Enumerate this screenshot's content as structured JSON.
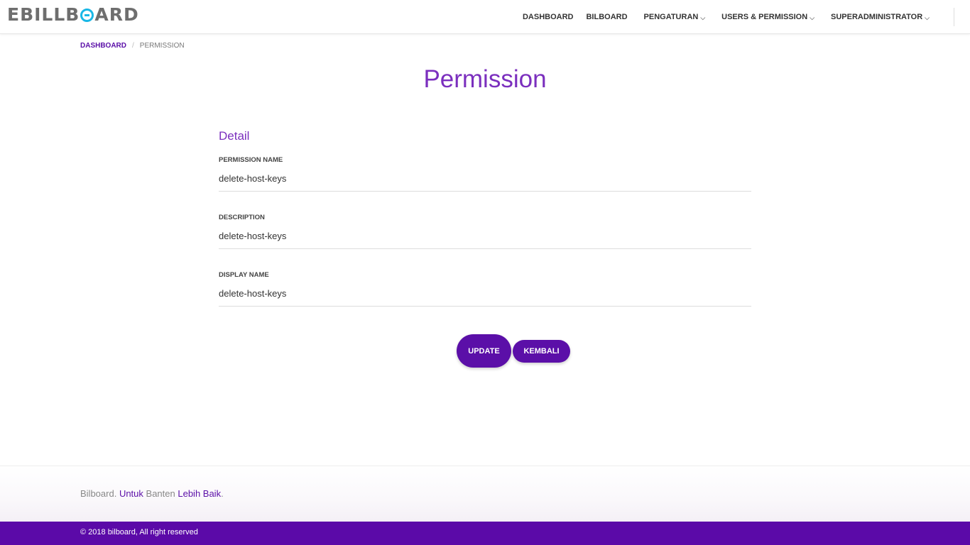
{
  "brand": {
    "logo_prefix": "EBILLB",
    "logo_suffix": "ARD",
    "accent_color": "#5b0fa8",
    "logo_mark_color": "#19b7e6"
  },
  "nav": {
    "items": [
      {
        "label": "DASHBOARD",
        "dropdown": false
      },
      {
        "label": "BILBOARD",
        "dropdown": false
      },
      {
        "label": "PENGATURAN",
        "dropdown": true
      },
      {
        "label": "USERS & PERMISSION",
        "dropdown": true
      },
      {
        "label": "SUPERADMINISTRATOR",
        "dropdown": true
      }
    ]
  },
  "breadcrumb": {
    "home": "DASHBOARD",
    "separator": "/",
    "current": "PERMISSION"
  },
  "page": {
    "title": "Permission"
  },
  "form": {
    "section_title": "Detail",
    "fields": [
      {
        "label": "PERMISSION NAME",
        "value": "delete-host-keys"
      },
      {
        "label": "DESCRIPTION",
        "value": "delete-host-keys"
      },
      {
        "label": "DISPLAY NAME",
        "value": "delete-host-keys"
      }
    ],
    "update_label": "UPDATE",
    "back_label": "KEMBALI"
  },
  "footer": {
    "tagline_start": "Bilboard.",
    "tagline_accent1": "Untuk",
    "tagline_mid": "Banten",
    "tagline_accent2": "Lebih Baik",
    "tagline_end": ".",
    "copyright": "© 2018 bilboard, All right reserved"
  }
}
